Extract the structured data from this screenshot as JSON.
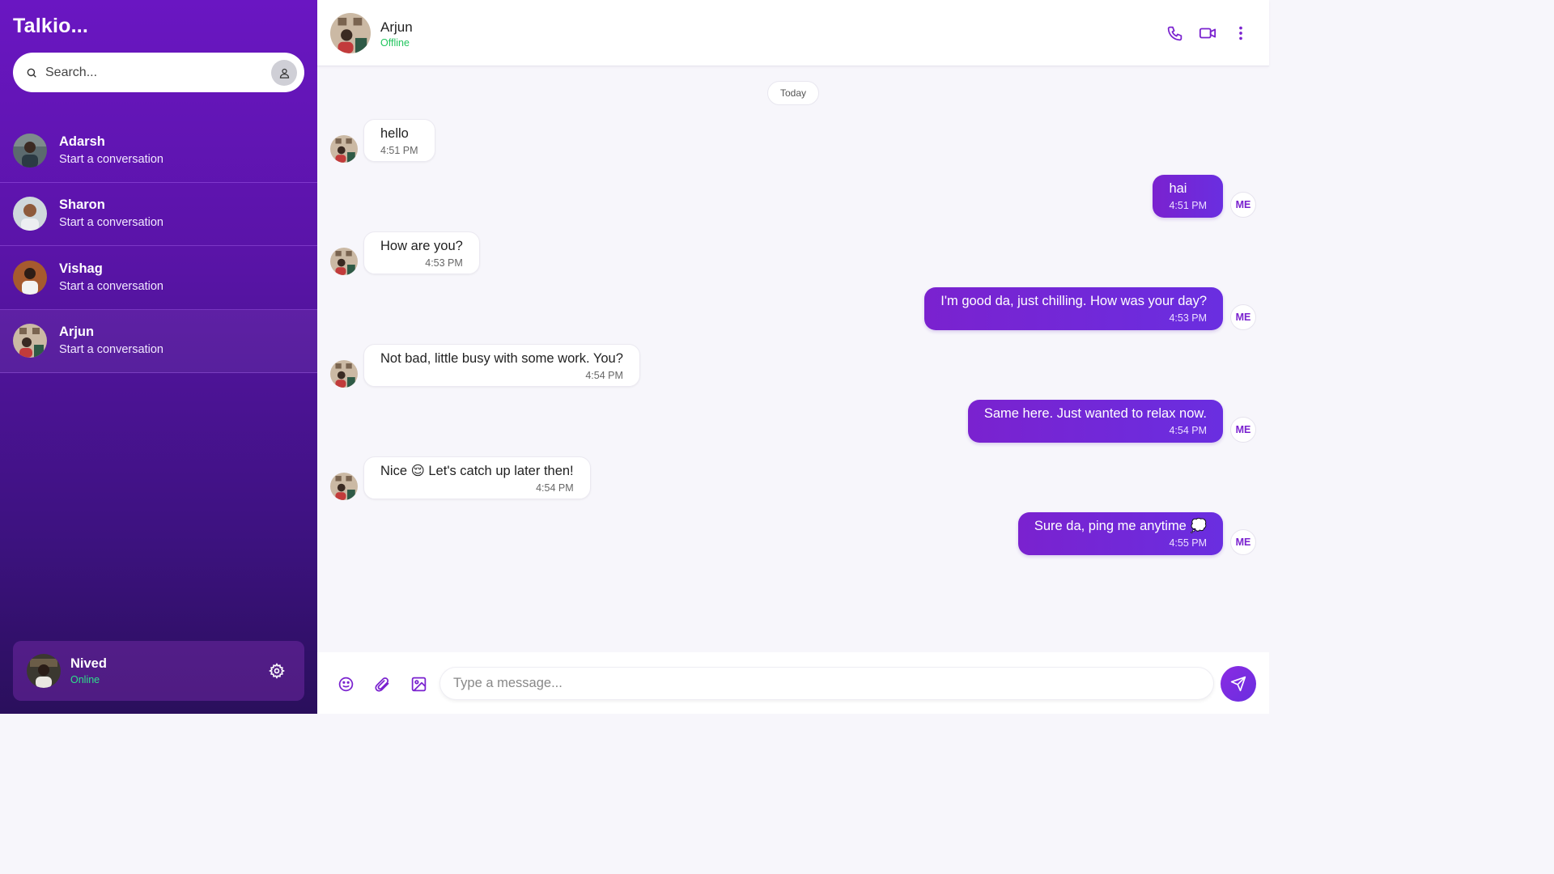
{
  "app": {
    "title": "Talkio..."
  },
  "search": {
    "placeholder": "Search..."
  },
  "conversations": [
    {
      "name": "Adarsh",
      "preview": "Start a conversation"
    },
    {
      "name": "Sharon",
      "preview": "Start a conversation"
    },
    {
      "name": "Vishag",
      "preview": "Start a conversation"
    },
    {
      "name": "Arjun",
      "preview": "Start a conversation"
    }
  ],
  "current_user": {
    "name": "Nived",
    "status": "Online"
  },
  "chat_header": {
    "name": "Arjun",
    "status": "Offline"
  },
  "day_separator": "Today",
  "messages": [
    {
      "from": "them",
      "text": "hello",
      "time": "4:51 PM"
    },
    {
      "from": "me",
      "text": "hai",
      "time": "4:51 PM"
    },
    {
      "from": "them",
      "text": "How are you?",
      "time": "4:53 PM"
    },
    {
      "from": "me",
      "text": "I'm good da, just chilling. How was your day?",
      "time": "4:53 PM"
    },
    {
      "from": "them",
      "text": "Not bad, little busy with some work. You?",
      "time": "4:54 PM"
    },
    {
      "from": "me",
      "text": "Same here. Just wanted to relax now.",
      "time": "4:54 PM"
    },
    {
      "from": "them",
      "text": "Nice 😌 Let's catch up later then!",
      "time": "4:54 PM"
    },
    {
      "from": "me",
      "text": "Sure da, ping me anytime 💭",
      "time": "4:55 PM"
    }
  ],
  "me_badge": "ME",
  "composer": {
    "placeholder": "Type a message..."
  },
  "icons": {
    "header": [
      "phone-icon",
      "video-icon",
      "more-vertical-icon"
    ],
    "composer": [
      "emoji-icon",
      "paperclip-icon",
      "image-icon",
      "send-icon"
    ]
  },
  "colors": {
    "accent": "#7a22cf",
    "online": "#2ee08a",
    "offline": "#22c55e"
  }
}
